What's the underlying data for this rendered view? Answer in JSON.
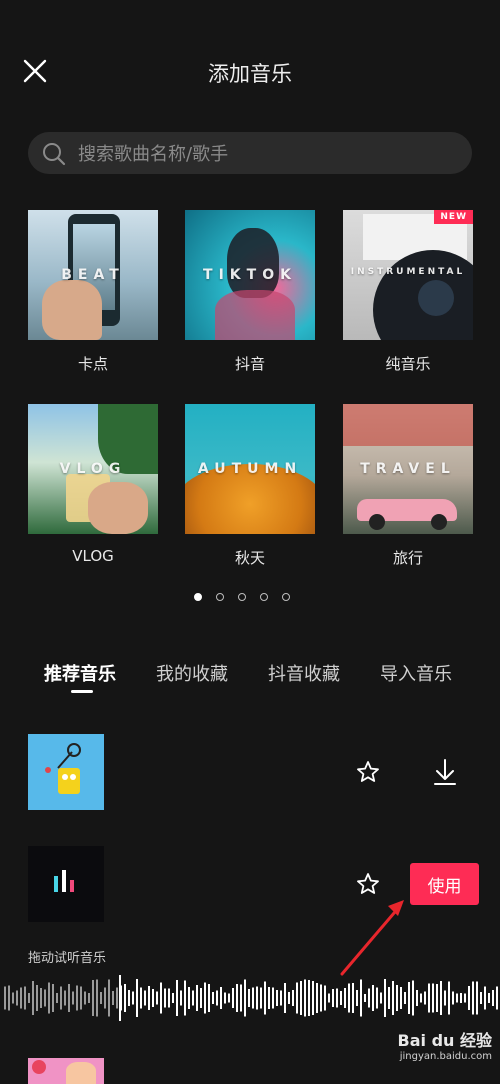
{
  "header": {
    "title": "添加音乐"
  },
  "search": {
    "placeholder": "搜索歌曲名称/歌手"
  },
  "categories": [
    {
      "label": "卡点",
      "word": "BEAT"
    },
    {
      "label": "抖音",
      "word": "TIKTOK"
    },
    {
      "label": "纯音乐",
      "word": "INSTRUMENTAL",
      "badge": "NEW"
    },
    {
      "label": "VLOG",
      "word": "VLOG"
    },
    {
      "label": "秋天",
      "word": "AUTUMN"
    },
    {
      "label": "旅行",
      "word": "TRAVEL"
    }
  ],
  "pager": {
    "total": 5,
    "active": 1
  },
  "tabs": [
    "推荐音乐",
    "我的收藏",
    "抖音收藏",
    "导入音乐"
  ],
  "list": {
    "use_label": "使用",
    "drag_hint": "拖动试听音乐"
  },
  "watermark": {
    "main": "Bai du 经验",
    "sub": "jingyan.baidu.com"
  },
  "colors": {
    "accent": "#fe2c55",
    "background": "#151515",
    "search_bg": "#2b2b2b"
  }
}
